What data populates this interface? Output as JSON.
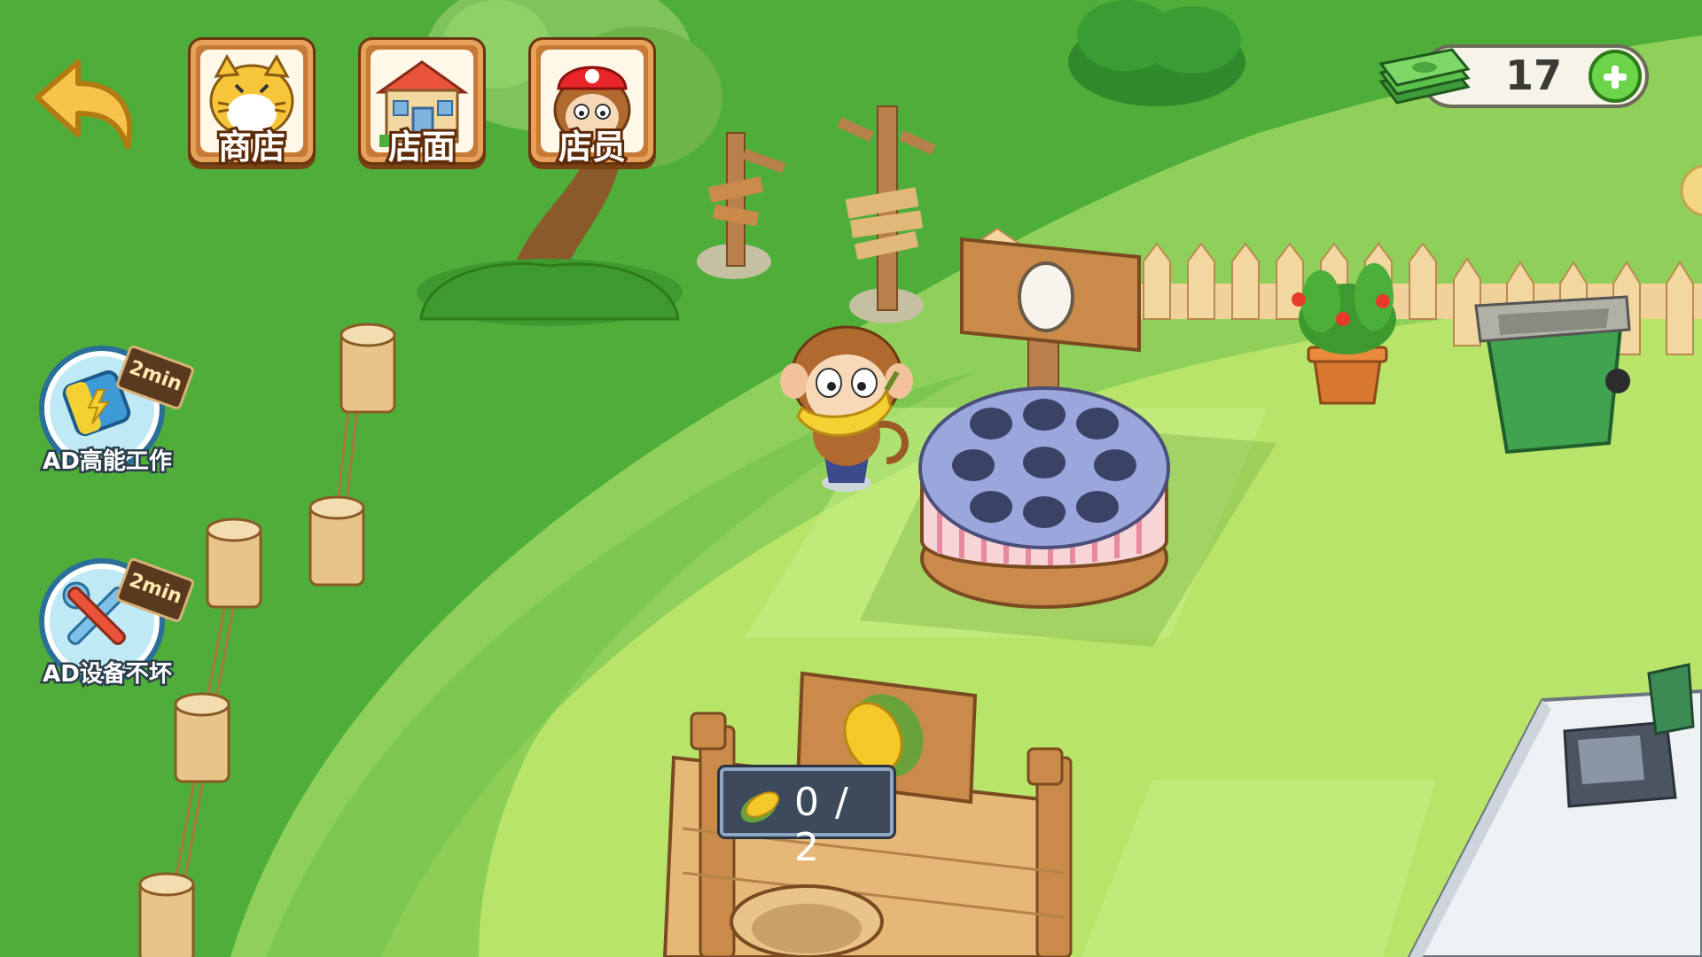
{
  "top_menu": {
    "back_icon": "back-arrow-icon",
    "shop": {
      "label": "商店",
      "icon": "tiger-icon"
    },
    "storefront": {
      "label": "店面",
      "icon": "house-icon"
    },
    "staff": {
      "label": "店员",
      "icon": "monkey-staff-icon"
    }
  },
  "currency": {
    "icon": "cash-stack-icon",
    "value": "17",
    "add_icon": "plus-icon"
  },
  "ad_boosts": [
    {
      "label": "AD高能工作",
      "timer": "2min",
      "icon": "battery-icon"
    },
    {
      "label": "AD设备不坏",
      "timer": "2min",
      "icon": "wrench-icon"
    }
  ],
  "station": {
    "progress": "0 / 2",
    "ingredient_icon": "corn-icon",
    "sign_icon": "corn-icon"
  },
  "machine": {
    "sign_icon": "egg-icon"
  },
  "props": {
    "trash_bin_label": "回收箱",
    "recycle_icon": "recycle-icon",
    "register_icon": "cash-register-icon"
  },
  "colors": {
    "grass_dark": "#4fae3a",
    "grass_light": "#b8e46a",
    "path": "#6fc24a",
    "wood": "#c98a4a",
    "accent_green": "#6bd449"
  }
}
